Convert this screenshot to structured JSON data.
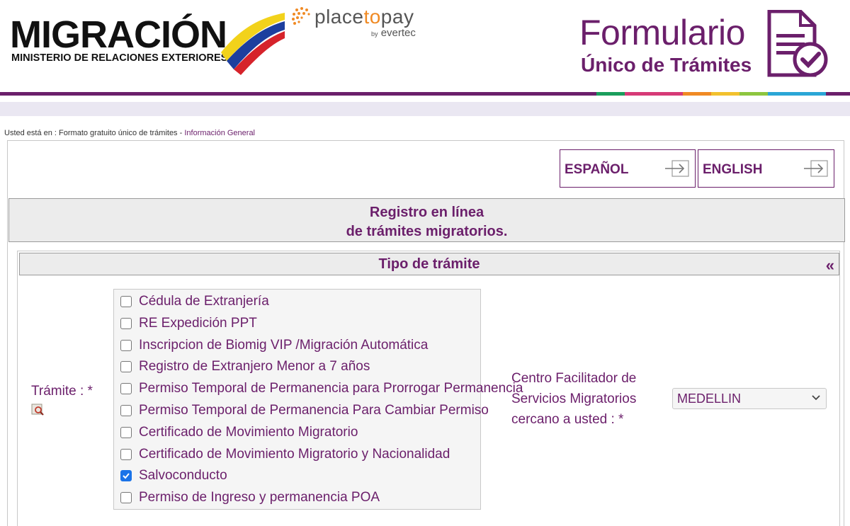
{
  "header": {
    "migracion": {
      "title": "MIGRACIÓN",
      "subtitle": "MINISTERIO DE RELACIONES EXTERIORES"
    },
    "placetopay": {
      "brand_a": "place",
      "brand_b": "to",
      "brand_c": "pay",
      "by": "by",
      "evertec": "evertec"
    },
    "formulario": {
      "line1": "Formulario",
      "line2": "Único de Trámites"
    }
  },
  "breadcrumb": {
    "prefix": "Usted está en : Formato gratuito único de trámites - ",
    "current": "Información General"
  },
  "language": {
    "spanish_label": "ESPAÑOL",
    "english_label": "ENGLISH"
  },
  "title": {
    "line1": "Registro en línea",
    "line2": "de trámites migratorios."
  },
  "section": {
    "heading": "Tipo de trámite",
    "collapse": "«"
  },
  "tramite": {
    "label": "Trámite : *",
    "options": [
      {
        "label": "Cédula de Extranjería",
        "checked": false
      },
      {
        "label": "RE Expedición PPT",
        "checked": false
      },
      {
        "label": "Inscripcion de Biomig VIP /Migración Automática",
        "checked": false
      },
      {
        "label": "Registro de Extranjero Menor a 7 años",
        "checked": false
      },
      {
        "label": "Permiso Temporal de Permanencia para Prorrogar Permanencia",
        "checked": false
      },
      {
        "label": "Permiso Temporal de Permanencia Para Cambiar Permiso",
        "checked": false
      },
      {
        "label": "Certificado de Movimiento Migratorio",
        "checked": false
      },
      {
        "label": "Certificado de Movimiento Migratorio y Nacionalidad",
        "checked": false
      },
      {
        "label": "Salvoconducto",
        "checked": true
      },
      {
        "label": "Permiso de Ingreso y permanencia POA",
        "checked": false
      }
    ]
  },
  "centro": {
    "label": "Centro Facilitador de Servicios Migratorios cercano a usted : *",
    "selected": "MEDELLIN"
  },
  "colors": {
    "brand_purple": "#6b1f6b",
    "strip": [
      "#1a9e5c",
      "#d63a77",
      "#f08a24",
      "#f2c12e",
      "#8dc63f",
      "#2aa6d6",
      "#6b1f6b"
    ]
  }
}
